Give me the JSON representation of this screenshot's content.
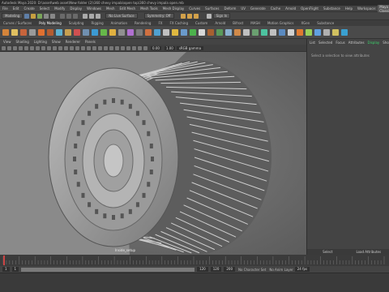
{
  "window": {
    "title": "Autodesk Maya 2020: D:\\asset\\web asset\\New folder (2)\\360 chevy impala\\open top\\360 chevy impala open.mb"
  },
  "menubar": {
    "items": [
      "File",
      "Edit",
      "Create",
      "Select",
      "Modify",
      "Display",
      "Windows",
      "Mesh",
      "Edit Mesh",
      "Mesh Tools",
      "Mesh Display",
      "Curves",
      "Surfaces",
      "Deform",
      "UV",
      "Generate",
      "Cache",
      "Arnold",
      "OpenFlight",
      "Substance",
      "Help"
    ],
    "workspace_label": "Workspace:",
    "workspace_value": "Maya Classic"
  },
  "statusline": {
    "mode": "Modeling",
    "live": "No Live Surface",
    "symmetry": "Symmetry: Off",
    "signin": "Sign In"
  },
  "shelf_tabs": [
    "Curves / Surfaces",
    "Poly Modeling",
    "Sculpting",
    "Rigging",
    "Animation",
    "Rendering",
    "FX",
    "FX Caching",
    "Custom",
    "Arnold",
    "Bifrost",
    "MASH",
    "Motion Graphics",
    "XGen",
    "Substance"
  ],
  "panel_menu": [
    "View",
    "Shading",
    "Lighting",
    "Show",
    "Renderer",
    "Panels"
  ],
  "viewport_toolbar": {
    "value1": "0.00",
    "value2": "1.00",
    "colorspace": "sRGB gamma"
  },
  "viewport": {
    "camera_label": "Inside_setup"
  },
  "right_panel": {
    "tabs": [
      "List",
      "Selected",
      "Focus",
      "Attributes",
      "Display",
      "Show",
      "Help"
    ],
    "active_tab": "Display",
    "message": "Select a selection to view attributes",
    "bottom": [
      "Select",
      "Load Attributes"
    ]
  },
  "range": {
    "start": "1",
    "start2": "1",
    "end": "120",
    "end2": "120",
    "end3": "200",
    "character_set": "No Character Set",
    "anim_layer": "No Anim Layer",
    "fps": "24 fps"
  },
  "colors": {
    "bg": "#444444",
    "viewport": "#6e6e6e",
    "accent": "#3bd36b"
  }
}
